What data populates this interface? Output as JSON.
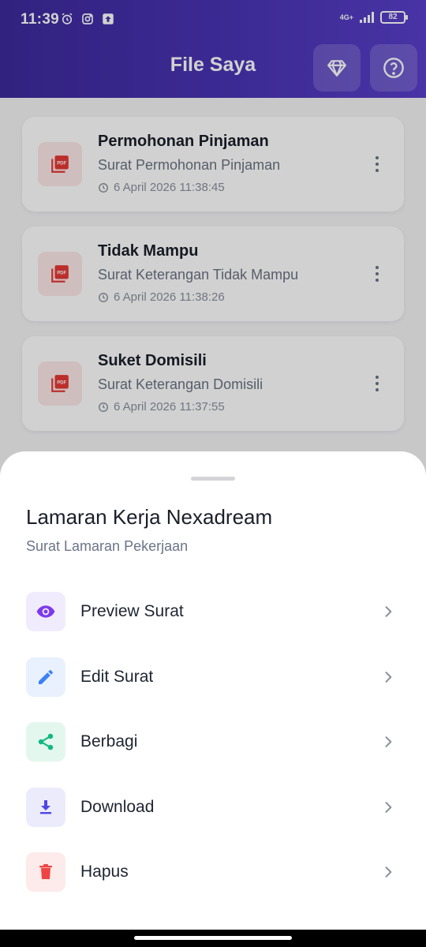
{
  "status_bar": {
    "time": "11:39",
    "network": "4G+",
    "battery": "82",
    "icons": [
      "alarm-icon",
      "instagram-icon",
      "upload-icon"
    ]
  },
  "header": {
    "title": "File Saya",
    "premium_icon": "diamond-icon",
    "help_icon": "help-circle-icon"
  },
  "files": [
    {
      "title": "Permohonan Pinjaman",
      "subtitle": "Surat Permohonan Pinjaman",
      "timestamp": "6 April 2026 11:38:45",
      "icon": "pdf-icon"
    },
    {
      "title": "Tidak Mampu",
      "subtitle": "Surat Keterangan Tidak Mampu",
      "timestamp": "6 April 2026 11:38:26",
      "icon": "pdf-icon"
    },
    {
      "title": "Suket Domisili",
      "subtitle": "Surat Keterangan Domisili",
      "timestamp": "6 April 2026 11:37:55",
      "icon": "pdf-icon"
    }
  ],
  "sheet": {
    "title": "Lamaran Kerja Nexadream",
    "subtitle": "Surat Lamaran Pekerjaan",
    "actions": [
      {
        "label": "Preview Surat",
        "icon": "eye-icon",
        "color": "#7c3aed",
        "bg": "#f1ecfd"
      },
      {
        "label": "Edit Surat",
        "icon": "pencil-icon",
        "color": "#3b82f6",
        "bg": "#e9f1fe"
      },
      {
        "label": "Berbagi",
        "icon": "share-icon",
        "color": "#10b981",
        "bg": "#e4f7ef"
      },
      {
        "label": "Download",
        "icon": "download-icon",
        "color": "#4f46e5",
        "bg": "#ecebfc"
      },
      {
        "label": "Hapus",
        "icon": "trash-icon",
        "color": "#ef4444",
        "bg": "#fdeaea"
      }
    ]
  }
}
